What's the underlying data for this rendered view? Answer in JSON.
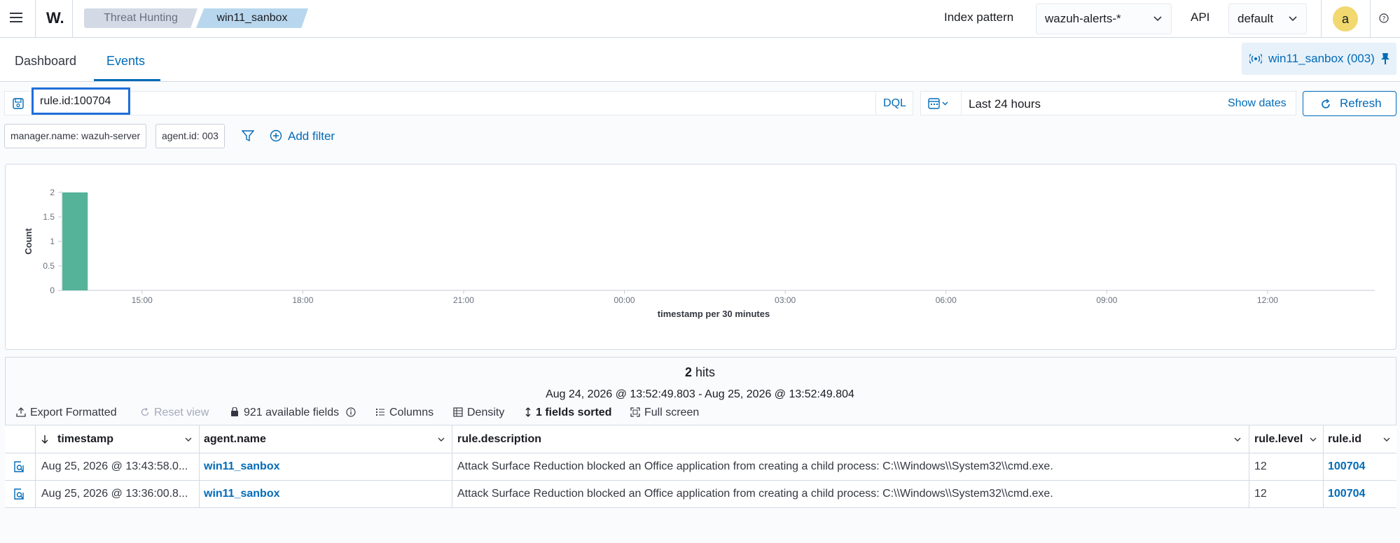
{
  "header": {
    "logo": "W.",
    "breadcrumb": [
      "Threat Hunting",
      "win11_sanbox"
    ],
    "index_pattern_label": "Index pattern",
    "index_pattern_value": "wazuh-alerts-*",
    "api_label": "API",
    "api_value": "default",
    "avatar_initial": "a"
  },
  "tabs": [
    "Dashboard",
    "Events"
  ],
  "active_tab": "Events",
  "agent_pill": "win11_sanbox (003)",
  "query": {
    "value": "rule.id:100704",
    "language": "DQL",
    "time_range": "Last 24 hours",
    "show_dates": "Show dates",
    "refresh": "Refresh"
  },
  "filters": [
    "manager.name: wazuh-server",
    "agent.id: 003"
  ],
  "add_filter": "Add filter",
  "chart_data": {
    "type": "bar",
    "ylabel": "Count",
    "xlabel": "timestamp per 30 minutes",
    "x_ticks": [
      "15:00",
      "18:00",
      "21:00",
      "00:00",
      "03:00",
      "06:00",
      "09:00",
      "12:00"
    ],
    "y_ticks": [
      "0",
      "0.5",
      "1",
      "1.5",
      "2"
    ],
    "ylim": [
      0,
      2
    ],
    "bars": [
      {
        "x": "13:30",
        "value": 2
      }
    ],
    "color": "#54b399"
  },
  "hits": {
    "count": "2",
    "label": "hits",
    "range": "Aug 24, 2026 @ 13:52:49.803 - Aug 25, 2026 @ 13:52:49.804"
  },
  "toolbar": {
    "export": "Export Formatted",
    "reset": "Reset view",
    "fields": "921 available fields",
    "columns": "Columns",
    "density": "Density",
    "sorted": "1 fields sorted",
    "fullscreen": "Full screen"
  },
  "table": {
    "columns": [
      "timestamp",
      "agent.name",
      "rule.description",
      "rule.level",
      "rule.id"
    ],
    "rows": [
      {
        "timestamp": "Aug 25, 2026 @ 13:43:58.0...",
        "agent": "win11_sanbox",
        "description": "Attack Surface Reduction blocked an Office application from creating a child process: C:\\\\Windows\\\\System32\\\\cmd.exe.",
        "level": "12",
        "rule_id": "100704"
      },
      {
        "timestamp": "Aug 25, 2026 @ 13:36:00.8...",
        "agent": "win11_sanbox",
        "description": "Attack Surface Reduction blocked an Office application from creating a child process: C:\\\\Windows\\\\System32\\\\cmd.exe.",
        "level": "12",
        "rule_id": "100704"
      }
    ]
  }
}
